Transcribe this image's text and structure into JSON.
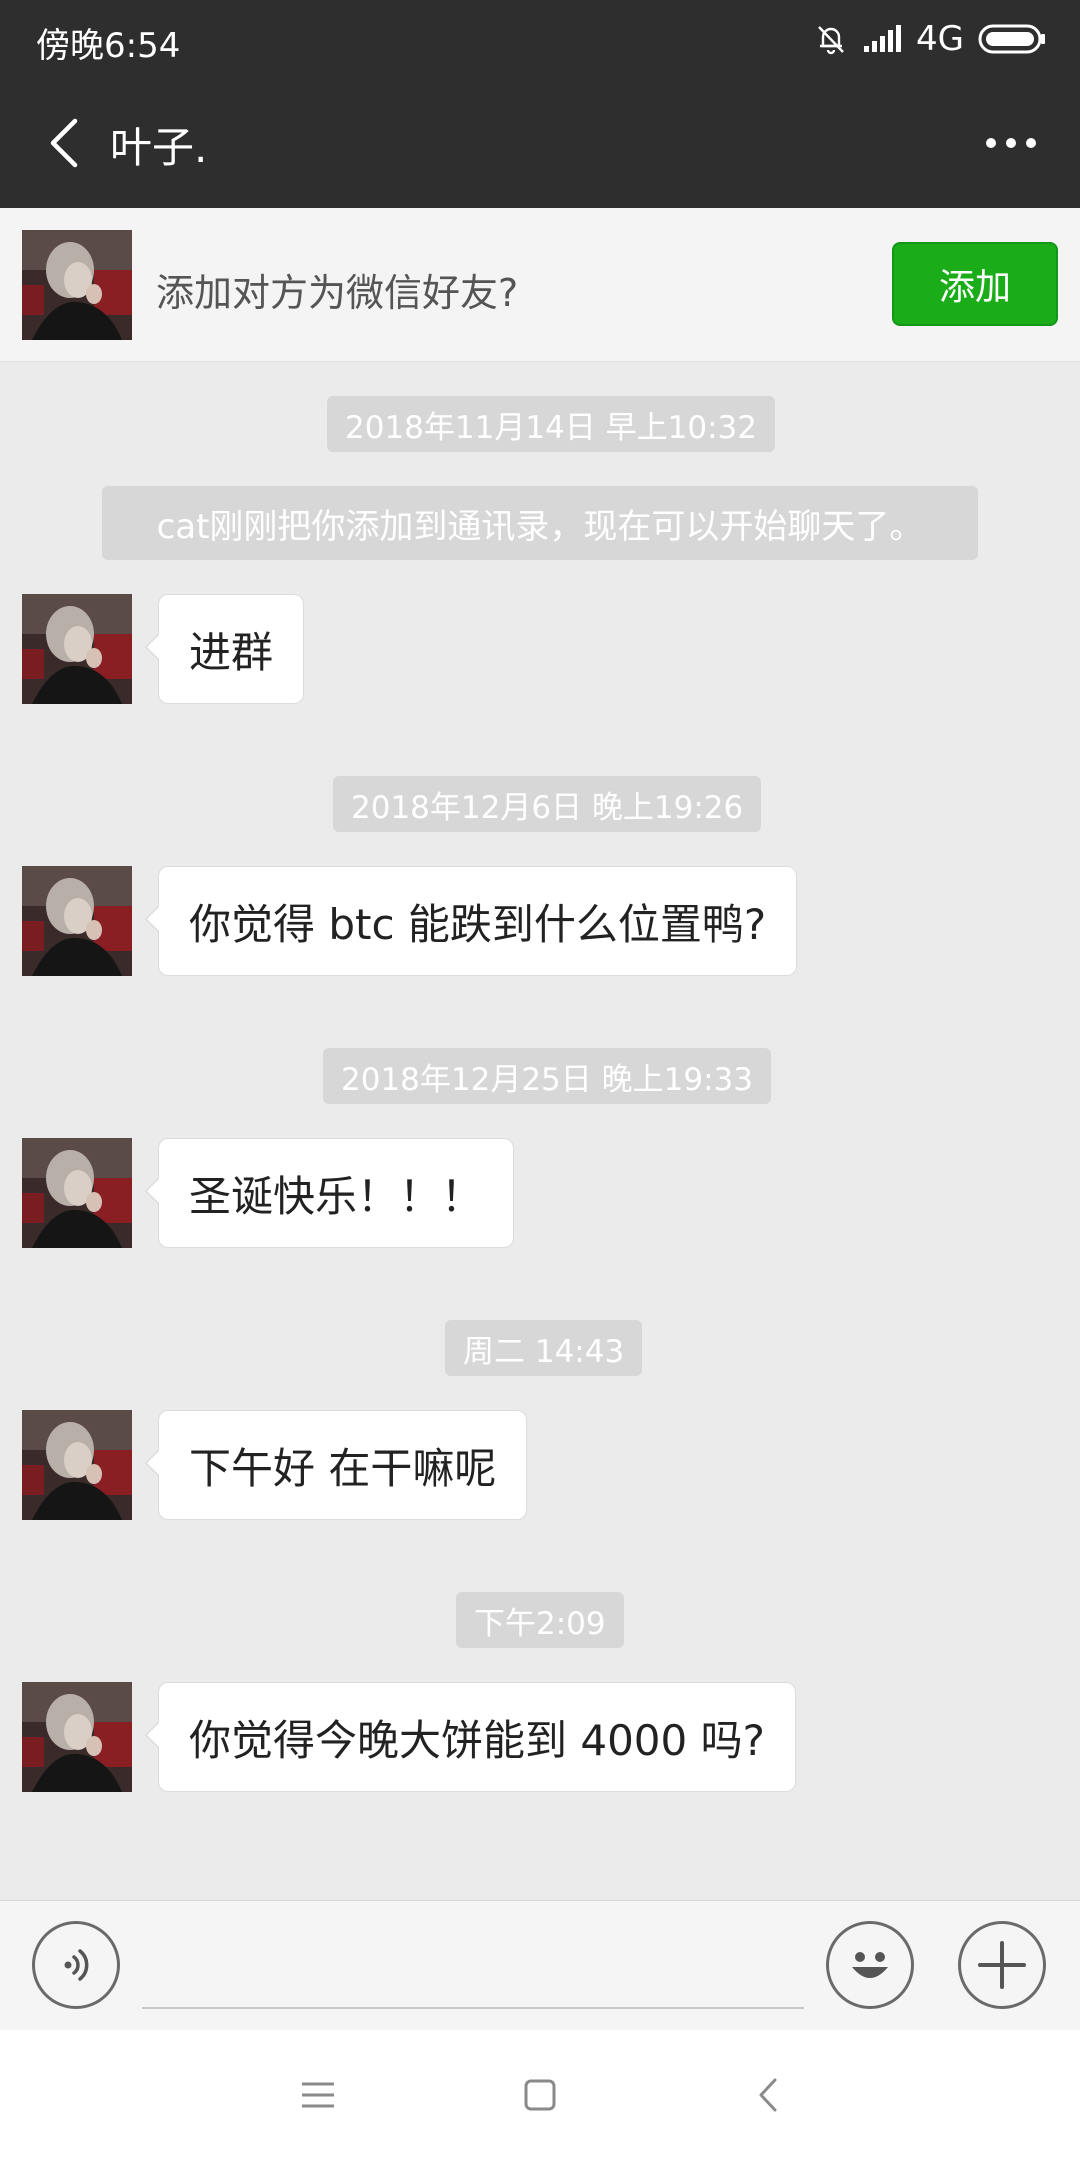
{
  "status_bar": {
    "time": "傍晚6:54",
    "network": "4G",
    "icons": [
      "mute-bell-icon",
      "signal-icon",
      "battery-icon"
    ]
  },
  "header": {
    "title": "叶子.",
    "icons": [
      "back-arrow-icon",
      "more-icon"
    ]
  },
  "add_banner": {
    "text": "添加对方为微信好友?",
    "button_label": "添加"
  },
  "chat": {
    "first_timestamp": "2018年11月14日 早上10:32",
    "system_message": "cat刚刚把你添加到通讯录，现在可以开始聊天了。",
    "messages": [
      {
        "text": "进群"
      },
      {
        "timestamp": "2018年12月6日 晚上19:26",
        "text": "你觉得 btc 能跌到什么位置鸭?"
      },
      {
        "timestamp": "2018年12月25日 晚上19:33",
        "text": "圣诞快乐！！！"
      },
      {
        "timestamp": "周二 14:43",
        "text": "下午好 在干嘛呢"
      },
      {
        "timestamp": "下午2:09",
        "text": "你觉得今晚大饼能到 4000 吗?"
      }
    ]
  },
  "input_bar": {
    "value": "",
    "icons": [
      "voice-icon",
      "emoji-icon",
      "plus-icon"
    ]
  },
  "nav_bar": {
    "icons": [
      "menu-icon",
      "home-square-icon",
      "back-triangle-icon"
    ]
  },
  "colors": {
    "header_bg": "#2e2e2e",
    "chat_bg": "#ebebeb",
    "add_button": "#1aad19",
    "timestamp_bg": "#d7d7d7"
  }
}
